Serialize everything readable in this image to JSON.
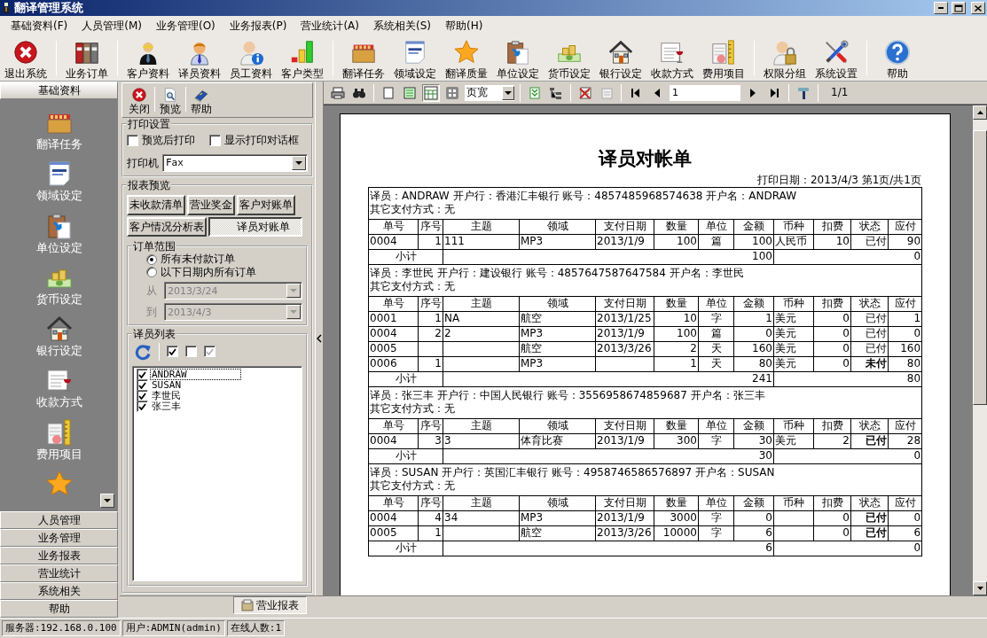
{
  "window": {
    "title": "翻译管理系统"
  },
  "menu": [
    {
      "label": "基础资料(F)"
    },
    {
      "label": "人员管理(M)"
    },
    {
      "label": "业务管理(O)"
    },
    {
      "label": "业务报表(P)"
    },
    {
      "label": "营业统计(A)"
    },
    {
      "label": "系统相关(S)"
    },
    {
      "label": "帮助(H)"
    }
  ],
  "toolbar": {
    "groups": [
      {
        "buttons": [
          {
            "label": "退出系统",
            "kind": "exit"
          }
        ]
      },
      {
        "buttons": [
          {
            "label": "业务订单",
            "kind": "binders"
          }
        ]
      },
      {
        "buttons": [
          {
            "label": "客户资料",
            "kind": "person-suit"
          },
          {
            "label": "译员资料",
            "kind": "person"
          },
          {
            "label": "员工资料",
            "kind": "person-info"
          },
          {
            "label": "客户类型",
            "kind": "bars"
          }
        ]
      },
      {
        "buttons": [
          {
            "label": "翻译任务",
            "kind": "crate"
          },
          {
            "label": "领域设定",
            "kind": "document"
          },
          {
            "label": "翻译质量",
            "kind": "star"
          },
          {
            "label": "单位设定",
            "kind": "clipboard"
          },
          {
            "label": "货币设定",
            "kind": "money"
          },
          {
            "label": "银行设定",
            "kind": "house"
          },
          {
            "label": "收款方式",
            "kind": "notepad"
          },
          {
            "label": "费用项目",
            "kind": "ruler"
          }
        ]
      },
      {
        "buttons": [
          {
            "label": "权限分组",
            "kind": "person-lock"
          },
          {
            "label": "系统设置",
            "kind": "tools"
          }
        ]
      },
      {
        "buttons": [
          {
            "label": "帮助",
            "kind": "help"
          }
        ]
      }
    ]
  },
  "nav": {
    "sections": [
      {
        "label": "基础资料",
        "expanded": true,
        "items": [
          {
            "label": "翻译任务",
            "kind": "crate"
          },
          {
            "label": "领域设定",
            "kind": "document"
          },
          {
            "label": "单位设定",
            "kind": "clipboard"
          },
          {
            "label": "货币设定",
            "kind": "money"
          },
          {
            "label": "银行设定",
            "kind": "house"
          },
          {
            "label": "收款方式",
            "kind": "notepad"
          },
          {
            "label": "费用项目",
            "kind": "ruler"
          },
          {
            "kind": "star"
          }
        ]
      },
      {
        "label": "人员管理",
        "expanded": false
      },
      {
        "label": "业务管理",
        "expanded": false
      },
      {
        "label": "业务报表",
        "expanded": false
      },
      {
        "label": "营业统计",
        "expanded": false
      },
      {
        "label": "系统相关",
        "expanded": false
      },
      {
        "label": "帮助",
        "expanded": false
      }
    ]
  },
  "settings": {
    "toolbar": [
      {
        "label": "关闭",
        "kind": "exit"
      },
      {
        "label": "预览",
        "kind": "preview"
      },
      {
        "label": "帮助",
        "kind": "book"
      }
    ],
    "print_settings": {
      "title": "打印设置",
      "options": [
        {
          "label": "预览后打印",
          "checked": false
        },
        {
          "label": "显示打印对话框",
          "checked": false
        }
      ],
      "printer_label": "打印机",
      "printer": "Fax"
    },
    "report_preview": {
      "title": "报表预览",
      "reports": [
        {
          "label": "未收款清单",
          "selected": false
        },
        {
          "label": "营业奖金",
          "selected": false
        },
        {
          "label": "客户对账单",
          "selected": false
        },
        {
          "label": "客户情况分析表",
          "selected": false
        },
        {
          "label": "译员对账单",
          "selected": true
        }
      ],
      "order_range": {
        "title": "订单范围",
        "options": [
          {
            "label": "所有未付款订单",
            "selected": true
          },
          {
            "label": "以下日期内所有订单",
            "selected": false
          }
        ],
        "from_label": "从",
        "from": "2013/3/24",
        "to_label": "到",
        "to": "2013/4/3",
        "dates_disabled": true
      },
      "translators": {
        "title": "译员列表",
        "items": [
          {
            "label": "ANDRAW",
            "checked": true,
            "focused": true
          },
          {
            "label": "SUSAN",
            "checked": true,
            "focused": false
          },
          {
            "label": "李世民",
            "checked": true,
            "focused": false
          },
          {
            "label": "张三丰",
            "checked": true,
            "focused": false
          }
        ]
      }
    }
  },
  "preview": {
    "view_modes": [
      {
        "selected": false
      },
      {
        "selected": false
      },
      {
        "selected": true
      },
      {
        "selected": false
      }
    ],
    "zoom": "页宽",
    "page": "1",
    "page_count": "1/1",
    "report": {
      "title": "译员对帐单",
      "print_info": "打印日期：2013/4/3 第1页/共1页",
      "blocks": [
        {
          "info": "译员：ANDRAW 开户行：香港汇丰银行  账号：4857485968574638 开户名：ANDRAW",
          "other_payment": "其它支付方式：无",
          "columns": [
            "单号",
            "序号",
            "主题",
            "领域",
            "支付日期",
            "数量",
            "单位",
            "金额",
            "币种",
            "扣费",
            "状态",
            "应付"
          ],
          "rows": [
            {
              "cells": [
                "0004",
                "1",
                "111",
                "MP3",
                "2013/1/9",
                "100",
                "篇",
                "100",
                "人民币",
                "10",
                "已付",
                "90"
              ],
              "status_bold": false
            }
          ],
          "subtotal": {
            "label": "小计",
            "amount": "100",
            "payable": "0"
          }
        },
        {
          "info": "译员：李世民 开户行：建设银行  账号：4857647587647584 开户名：李世民",
          "other_payment": "其它支付方式：无",
          "columns": [
            "单号",
            "序号",
            "主题",
            "领域",
            "支付日期",
            "数量",
            "单位",
            "金额",
            "币种",
            "扣费",
            "状态",
            "应付"
          ],
          "rows": [
            {
              "cells": [
                "0001",
                "1",
                "NA",
                "航空",
                "2013/1/25",
                "10",
                "字",
                "1",
                "美元",
                "0",
                "已付",
                "1"
              ],
              "status_bold": false
            },
            {
              "cells": [
                "0004",
                "2",
                "2",
                "MP3",
                "2013/1/9",
                "100",
                "篇",
                "0",
                "美元",
                "0",
                "已付",
                "0"
              ],
              "status_bold": false
            },
            {
              "cells": [
                "0005",
                null,
                null,
                "航空",
                "2013/3/26",
                "2",
                "天",
                "160",
                "美元",
                "0",
                "已付",
                "160"
              ],
              "status_bold": false
            },
            {
              "cells": [
                "0006",
                "1",
                null,
                "MP3",
                null,
                "1",
                "天",
                "80",
                "美元",
                "0",
                "未付",
                "80"
              ],
              "status_bold": true
            }
          ],
          "subtotal": {
            "label": "小计",
            "amount": "241",
            "payable": "80"
          }
        },
        {
          "info": "译员：张三丰 开户行：中国人民银行  账号：3556958674859687 开户名：张三丰",
          "other_payment": "其它支付方式：无",
          "columns": [
            "单号",
            "序号",
            "主题",
            "领域",
            "支付日期",
            "数量",
            "单位",
            "金额",
            "币种",
            "扣费",
            "状态",
            "应付"
          ],
          "rows": [
            {
              "cells": [
                "0004",
                "3",
                "3",
                "体育比赛",
                "2013/1/9",
                "300",
                "字",
                "30",
                "美元",
                "2",
                "已付",
                "28"
              ],
              "status_bold": true
            }
          ],
          "subtotal": {
            "label": "小计",
            "amount": "30",
            "payable": "0"
          }
        },
        {
          "info": "译员：SUSAN 开户行：英国汇丰银行  账号：4958746586576897 开户名：SUSAN",
          "other_payment": "其它支付方式：无",
          "columns": [
            "单号",
            "序号",
            "主题",
            "领域",
            "支付日期",
            "数量",
            "单位",
            "金额",
            "币种",
            "扣费",
            "状态",
            "应付"
          ],
          "rows": [
            {
              "cells": [
                "0004",
                "4",
                "34",
                "MP3",
                "2013/1/9",
                "3000",
                "字",
                "0",
                null,
                "0",
                "已付",
                "0"
              ],
              "status_bold": true
            },
            {
              "cells": [
                "0005",
                "1",
                null,
                "航空",
                "2013/3/26",
                "10000",
                "字",
                "6",
                null,
                "0",
                "已付",
                "6"
              ],
              "status_bold": true
            }
          ],
          "subtotal": {
            "label": "小计",
            "amount": "6",
            "payable": "0"
          }
        }
      ]
    }
  },
  "bottom_tabs": [
    {
      "label": "营业报表",
      "selected": true
    }
  ],
  "status_bar": [
    "服务器:192.168.0.100",
    "用户:ADMIN(admin)",
    "在线人数:1"
  ]
}
